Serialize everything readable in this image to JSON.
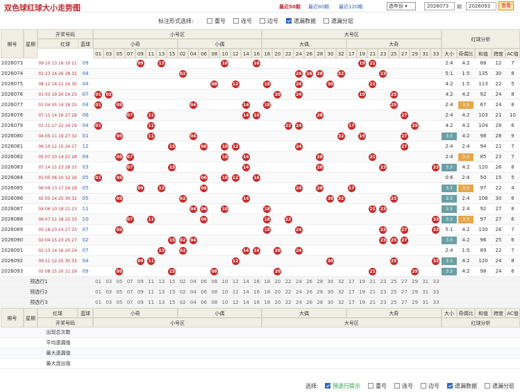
{
  "header": {
    "title": "双色球红球大小走势图",
    "links": [
      "最近50期",
      "最近80期",
      "最近120期"
    ],
    "year_select": "选年份",
    "from_label": "",
    "from_value": "2026073",
    "period1": "期",
    "to_label": "至",
    "to_value": "2026093",
    "period2": "期",
    "query": "查看"
  },
  "options": {
    "label": "标注形式选择:",
    "items": [
      {
        "label": "重号",
        "checked": false
      },
      {
        "label": "连号",
        "checked": false
      },
      {
        "label": "边号",
        "checked": false
      },
      {
        "label": "遗漏数据",
        "checked": true
      },
      {
        "label": "遗漏分层",
        "checked": false
      }
    ]
  },
  "columns": {
    "issue": "期号",
    "weekday": "星期",
    "draw": "开奖号码",
    "red": "红球",
    "blue": "蓝球",
    "small_zone": "小号区",
    "big_zone": "大号区",
    "sub": [
      "小奇",
      "小偶",
      "大偶",
      "大奇"
    ],
    "analysis": "红球分析",
    "analysis_cols": [
      "大小比",
      "奇偶比",
      "和值",
      "跨度",
      "AC值"
    ]
  },
  "nums": {
    "xiaoqi": [
      "01",
      "03",
      "05",
      "07",
      "09",
      "11",
      "13",
      "15"
    ],
    "xiaoou": [
      "02",
      "04",
      "06",
      "08",
      "10",
      "12",
      "14",
      "16"
    ],
    "daou": [
      "18",
      "20",
      "22",
      "24",
      "26",
      "28",
      "30",
      "32"
    ],
    "daqi": [
      "17",
      "19",
      "21",
      "23",
      "25",
      "27",
      "29",
      "31",
      "33"
    ]
  },
  "rows": [
    {
      "issue": "2026073",
      "red": "09 10 13 16 19 21",
      "blue": "09",
      "dx": "2:4",
      "jo": "4:2",
      "sum": "88",
      "span": "12",
      "ac": "7"
    },
    {
      "issue": "2026074",
      "red": "02 23 24 26 28 32",
      "blue": "04",
      "dx": "5:1",
      "jo": "1:5",
      "sum": "135",
      "span": "30",
      "ac": "8"
    },
    {
      "issue": "2026075",
      "red": "08 12 18 21 24 30",
      "blue": "04",
      "dx": "4:2",
      "jo": "1:5",
      "sum": "113",
      "span": "22",
      "ac": "5"
    },
    {
      "issue": "2026076",
      "red": "01 03 19 20 24 25",
      "blue": "07",
      "dx": "4:2",
      "jo": "4:2",
      "sum": "92",
      "span": "24",
      "ac": "8"
    },
    {
      "issue": "2026077",
      "red": "01 04 05 14 18 25",
      "blue": "04",
      "dx": "2:4",
      "jo": "3:3",
      "sum": "67",
      "span": "24",
      "ac": "8"
    },
    {
      "issue": "2026078",
      "red": "07 11 14 16 27 28",
      "blue": "06",
      "dx": "2:4",
      "jo": "4:2",
      "sum": "103",
      "span": "21",
      "ac": "10"
    },
    {
      "issue": "2026079",
      "red": "01 11 17 22 24 29",
      "blue": "04",
      "dx": "4:2",
      "jo": "4:2",
      "sum": "104",
      "span": "28",
      "ac": "6"
    },
    {
      "issue": "2026080",
      "red": "04 05 11 19 27 32",
      "blue": "01",
      "dx": "3:3",
      "jo": "4:2",
      "sum": "98",
      "span": "28",
      "ac": "9"
    },
    {
      "issue": "2026081",
      "red": "06 10 12 15 24 27",
      "blue": "12",
      "dx": "2:4",
      "jo": "2:4",
      "sum": "94",
      "span": "21",
      "ac": "7"
    },
    {
      "issue": "2026082",
      "red": "05 07 10 14 21 28",
      "blue": "04",
      "dx": "2:4",
      "jo": "3:3",
      "sum": "85",
      "span": "23",
      "ac": "7"
    },
    {
      "issue": "2026083",
      "red": "07 14 15 23 28 33",
      "blue": "03",
      "dx": "3:3",
      "jo": "4:2",
      "sum": "120",
      "span": "26",
      "ac": "8"
    },
    {
      "issue": "2026084",
      "red": "01 05 06 10 12 16",
      "blue": "05",
      "dx": "0:6",
      "jo": "2:4",
      "sum": "50",
      "span": "15",
      "ac": "5"
    },
    {
      "issue": "2026085",
      "red": "06 09 13 17 24 28",
      "blue": "05",
      "dx": "3:3",
      "jo": "3:3",
      "sum": "97",
      "span": "22",
      "ac": "4"
    },
    {
      "issue": "2026086",
      "red": "02 05 14 25 30 32",
      "blue": "05",
      "dx": "3:3",
      "jo": "2:4",
      "sum": "108",
      "span": "30",
      "ac": "6"
    },
    {
      "issue": "2026087",
      "red": "04 06 10 18 21 23",
      "blue": "11",
      "dx": "3:3",
      "jo": "2:4",
      "sum": "92",
      "span": "27",
      "ac": "8"
    },
    {
      "issue": "2026088",
      "red": "06 07 11 18 22 33",
      "blue": "10",
      "dx": "3:3",
      "jo": "3:3",
      "sum": "97",
      "span": "27",
      "ac": "6"
    },
    {
      "issue": "2026089",
      "red": "05 18 23 24 27 33",
      "blue": "07",
      "dx": "5:1",
      "jo": "4:2",
      "sum": "130",
      "span": "28",
      "ac": "7"
    },
    {
      "issue": "2026090",
      "red": "02 04 15 23 25 27",
      "blue": "02",
      "dx": "3:3",
      "jo": "4:2",
      "sum": "96",
      "span": "25",
      "ac": "6"
    },
    {
      "issue": "2026091",
      "red": "02 13 14 16 20 24",
      "blue": "07",
      "dx": "2:4",
      "jo": "1:5",
      "sum": "89",
      "span": "22",
      "ac": "7"
    },
    {
      "issue": "2026092",
      "red": "09 11 12 25 30 33",
      "blue": "04",
      "dx": "3:3",
      "jo": "4:2",
      "sum": "120",
      "span": "24",
      "ac": "8"
    },
    {
      "issue": "2026093",
      "red": "05 08 15 20 21 29",
      "blue": "09",
      "dx": "3:3",
      "jo": "4:2",
      "sum": "98",
      "span": "24",
      "ac": "6"
    }
  ],
  "presel": [
    "预选行1",
    "预选行2",
    "预选行3"
  ],
  "stats": {
    "labels": [
      "出现总次数",
      "平均遗漏值",
      "最大遗漏值",
      "最大连出值"
    ]
  },
  "bottom": {
    "label": "选择:",
    "items": [
      {
        "label": "预选行提示",
        "checked": true
      },
      {
        "label": "重号",
        "checked": false
      },
      {
        "label": "连号",
        "checked": false
      },
      {
        "label": "边号",
        "checked": false
      },
      {
        "label": "遗漏数据",
        "checked": true
      },
      {
        "label": "遗漏分层",
        "checked": false
      }
    ]
  }
}
